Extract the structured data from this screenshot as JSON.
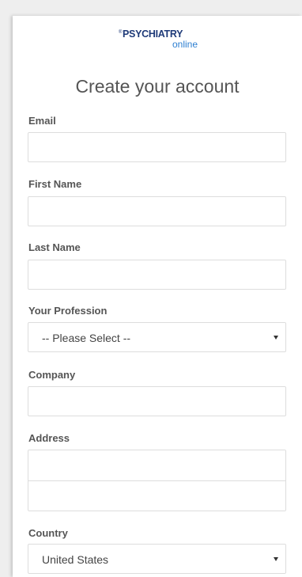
{
  "logo": {
    "tm": "®",
    "main": "PSYCHIATRY",
    "sub": "online"
  },
  "title": "Create your account",
  "form": {
    "email_label": "Email",
    "email_value": "",
    "first_name_label": "First Name",
    "first_name_value": "",
    "last_name_label": "Last Name",
    "last_name_value": "",
    "profession_label": "Your Profession",
    "profession_selected": "-- Please Select --",
    "company_label": "Company",
    "company_value": "",
    "address_label": "Address",
    "address_line1_value": "",
    "address_line2_value": "",
    "country_label": "Country",
    "country_selected": "United States"
  },
  "icons": {
    "dropdown": "chevron-down-icon"
  },
  "colors": {
    "logo_main": "#1e3a78",
    "logo_sub": "#2d7fd1",
    "label": "#555555",
    "border": "#dddddd",
    "background": "#eeeeee"
  }
}
